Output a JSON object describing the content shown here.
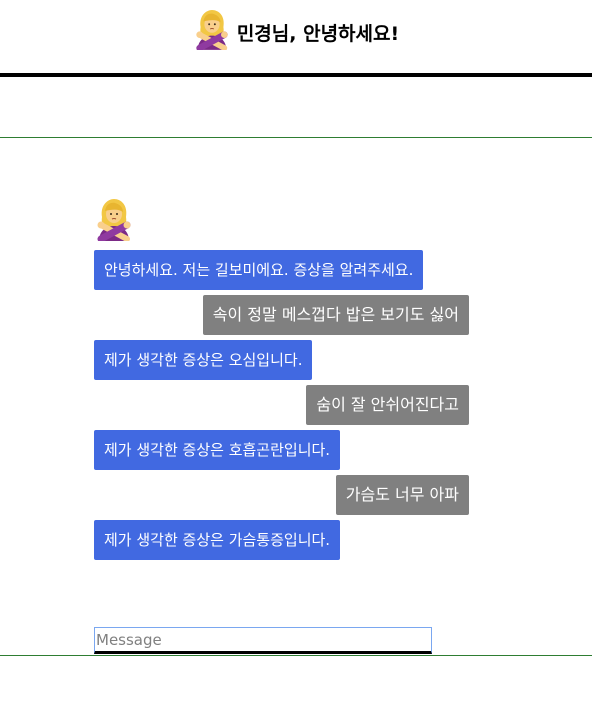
{
  "header": {
    "emoji_icon": "person-gesturing-no-icon",
    "title": "민경님, 안녕하세요!"
  },
  "chat": {
    "bot_avatar_icon": "person-gesturing-no-icon",
    "messages": [
      {
        "sender": "bot",
        "text": "안녕하세요. 저는 길보미에요. 증상을 알려주세요."
      },
      {
        "sender": "user",
        "text": "속이 정말 메스껍다 밥은 보기도 싫어"
      },
      {
        "sender": "bot",
        "text": "제가 생각한 증상은 오심입니다."
      },
      {
        "sender": "user",
        "text": "숨이 잘 안쉬어진다고"
      },
      {
        "sender": "bot",
        "text": "제가 생각한 증상은 호흡곤란입니다."
      },
      {
        "sender": "user",
        "text": "가슴도 너무 아파"
      },
      {
        "sender": "bot",
        "text": "제가 생각한 증상은 가슴통증입니다."
      }
    ]
  },
  "input": {
    "placeholder": "Message",
    "value": ""
  },
  "colors": {
    "bot_bubble": "#4169e1",
    "user_bubble": "#808080",
    "header_border": "#000000",
    "divider": "#2e7d32"
  }
}
